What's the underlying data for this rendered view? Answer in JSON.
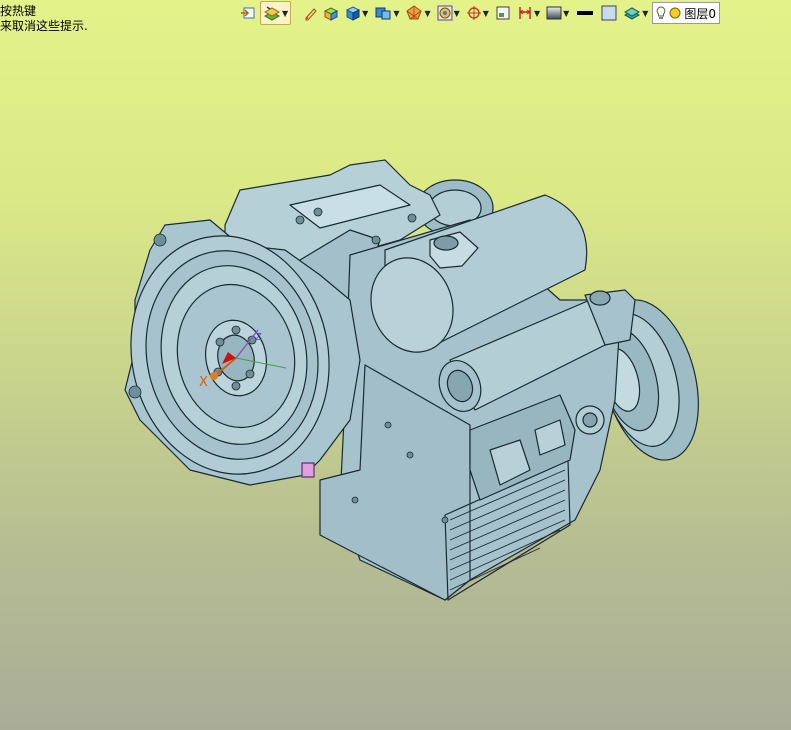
{
  "hint": {
    "line1": "按热键",
    "line2": "来取消这些提示."
  },
  "toolbar": {
    "icons": [
      "sketch-plane-icon",
      "layer-filter-icon",
      "edit-pencil-icon",
      "add-box-icon",
      "solid-box-icon",
      "view-cube-icon",
      "render-sphere-icon",
      "display-mode-icon",
      "snap-point-icon",
      "grid-window-icon",
      "dimension-icon",
      "background-shade-icon",
      "line-weight-icon",
      "color-square-icon",
      "layer-stack-icon"
    ],
    "layer_label": "图层0"
  },
  "axis": {
    "x_label": "X",
    "y_label": "Y",
    "z_label": "Z"
  }
}
